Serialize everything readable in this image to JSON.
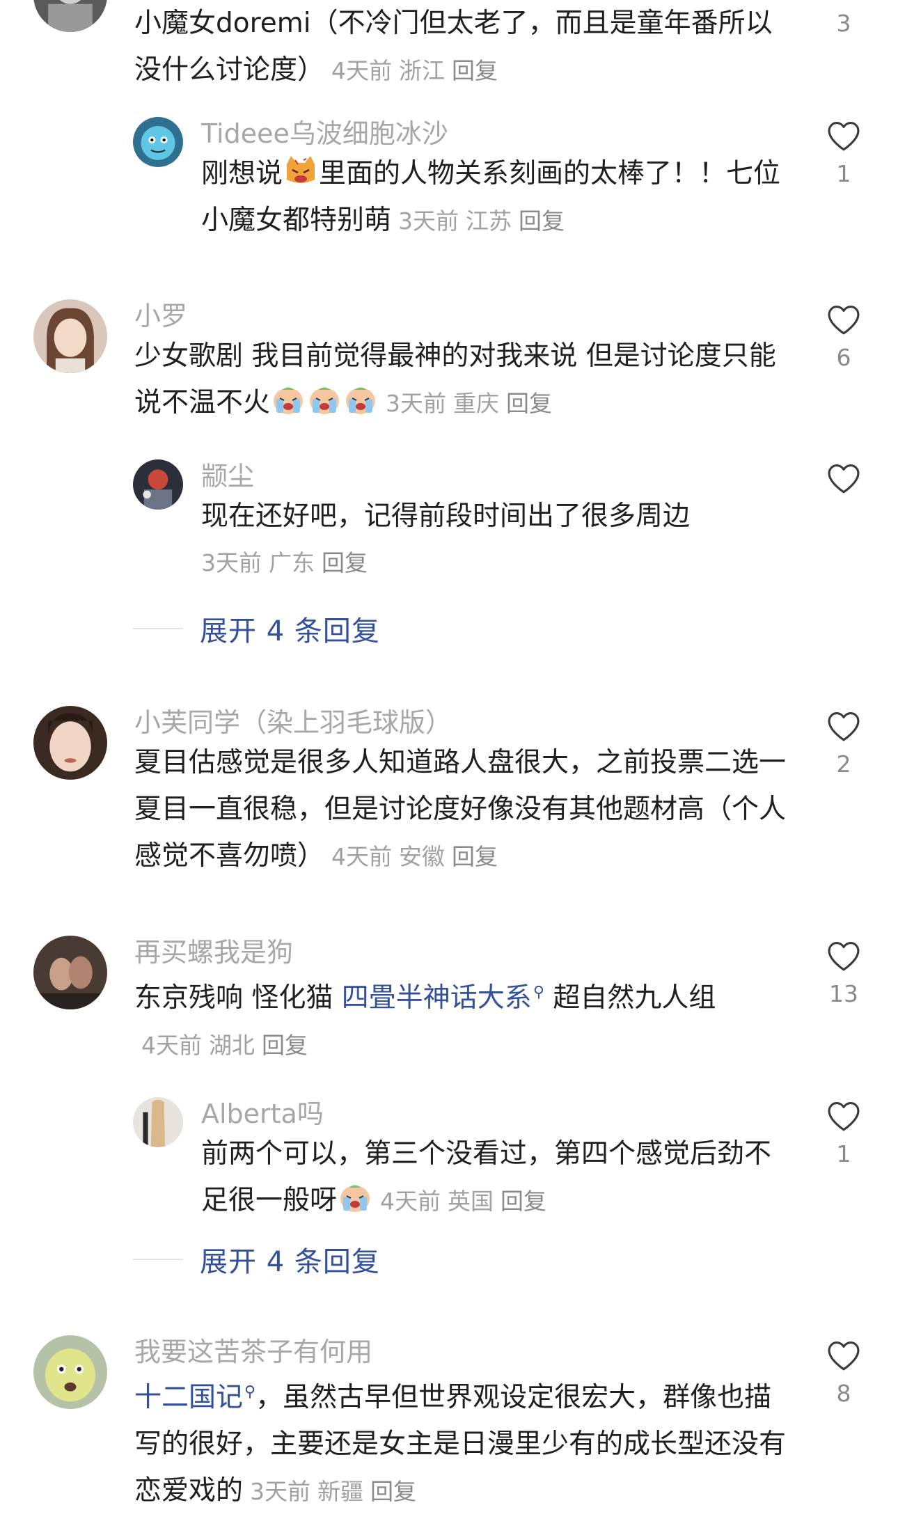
{
  "comments": [
    {
      "user": "",
      "text": "小魔女doremi（不冷门但太老了，而且是童年番所以没什么讨论度）",
      "time": "4天前",
      "region": "浙江",
      "reply": "回复",
      "likes": "3"
    },
    {
      "user": "Tideee乌波细胞冰沙",
      "text_a": "刚想说",
      "text_b": "里面的人物关系刻画的太棒了！！七位小魔女都特别萌",
      "time": "3天前",
      "region": "江苏",
      "reply": "回复",
      "likes": "1"
    },
    {
      "user": "小罗",
      "text": "少女歌剧 我目前觉得最神的对我来说 但是讨论度只能说不温不火",
      "time": "3天前",
      "region": "重庆",
      "reply": "回复",
      "likes": "6"
    },
    {
      "user": "颛尘",
      "text": "现在还好吧，记得前段时间出了很多周边",
      "time": "3天前",
      "region": "广东",
      "reply": "回复",
      "likes": ""
    },
    {
      "user": "小芙同学（染上羽毛球版）",
      "text": "夏目估感觉是很多人知道路人盘很大，之前投票二选一夏目一直很稳，但是讨论度好像没有其他题材高（个人感觉不喜勿喷）",
      "time": "4天前",
      "region": "安徽",
      "reply": "回复",
      "likes": "2"
    },
    {
      "user": "再买螺我是狗",
      "text_a": "东京残响 怪化猫 ",
      "link": "四畳半神话大系",
      "text_b": "超自然九人组",
      "time": "4天前",
      "region": "湖北",
      "reply": "回复",
      "likes": "13"
    },
    {
      "user": "Alberta吗",
      "text": "前两个可以，第三个没看过，第四个感觉后劲不足很一般呀",
      "time": "4天前",
      "region": "英国",
      "reply": "回复",
      "likes": "1"
    },
    {
      "user": "我要这苦茶子有何用",
      "link": "十二国记",
      "text_b": "，虽然古早但世界观设定很宏大，群像也描写的很好，主要还是女主是日漫里少有的成长型还没有恋爱戏的",
      "time": "3天前",
      "region": "新疆",
      "reply": "回复",
      "likes": "8"
    }
  ],
  "expand": [
    {
      "label": "展开 4 条回复"
    },
    {
      "label": "展开 4 条回复"
    }
  ],
  "icons": {
    "like": "heart-outline-icon",
    "search": "search-mark-icon",
    "emoji_cat": "angry-cat-emoji",
    "emoji_cry": "crying-face-emoji"
  },
  "colors": {
    "link": "#33519a",
    "username": "#a7a7a7",
    "meta": "#a1a1a1",
    "text": "#1f1f1f"
  }
}
